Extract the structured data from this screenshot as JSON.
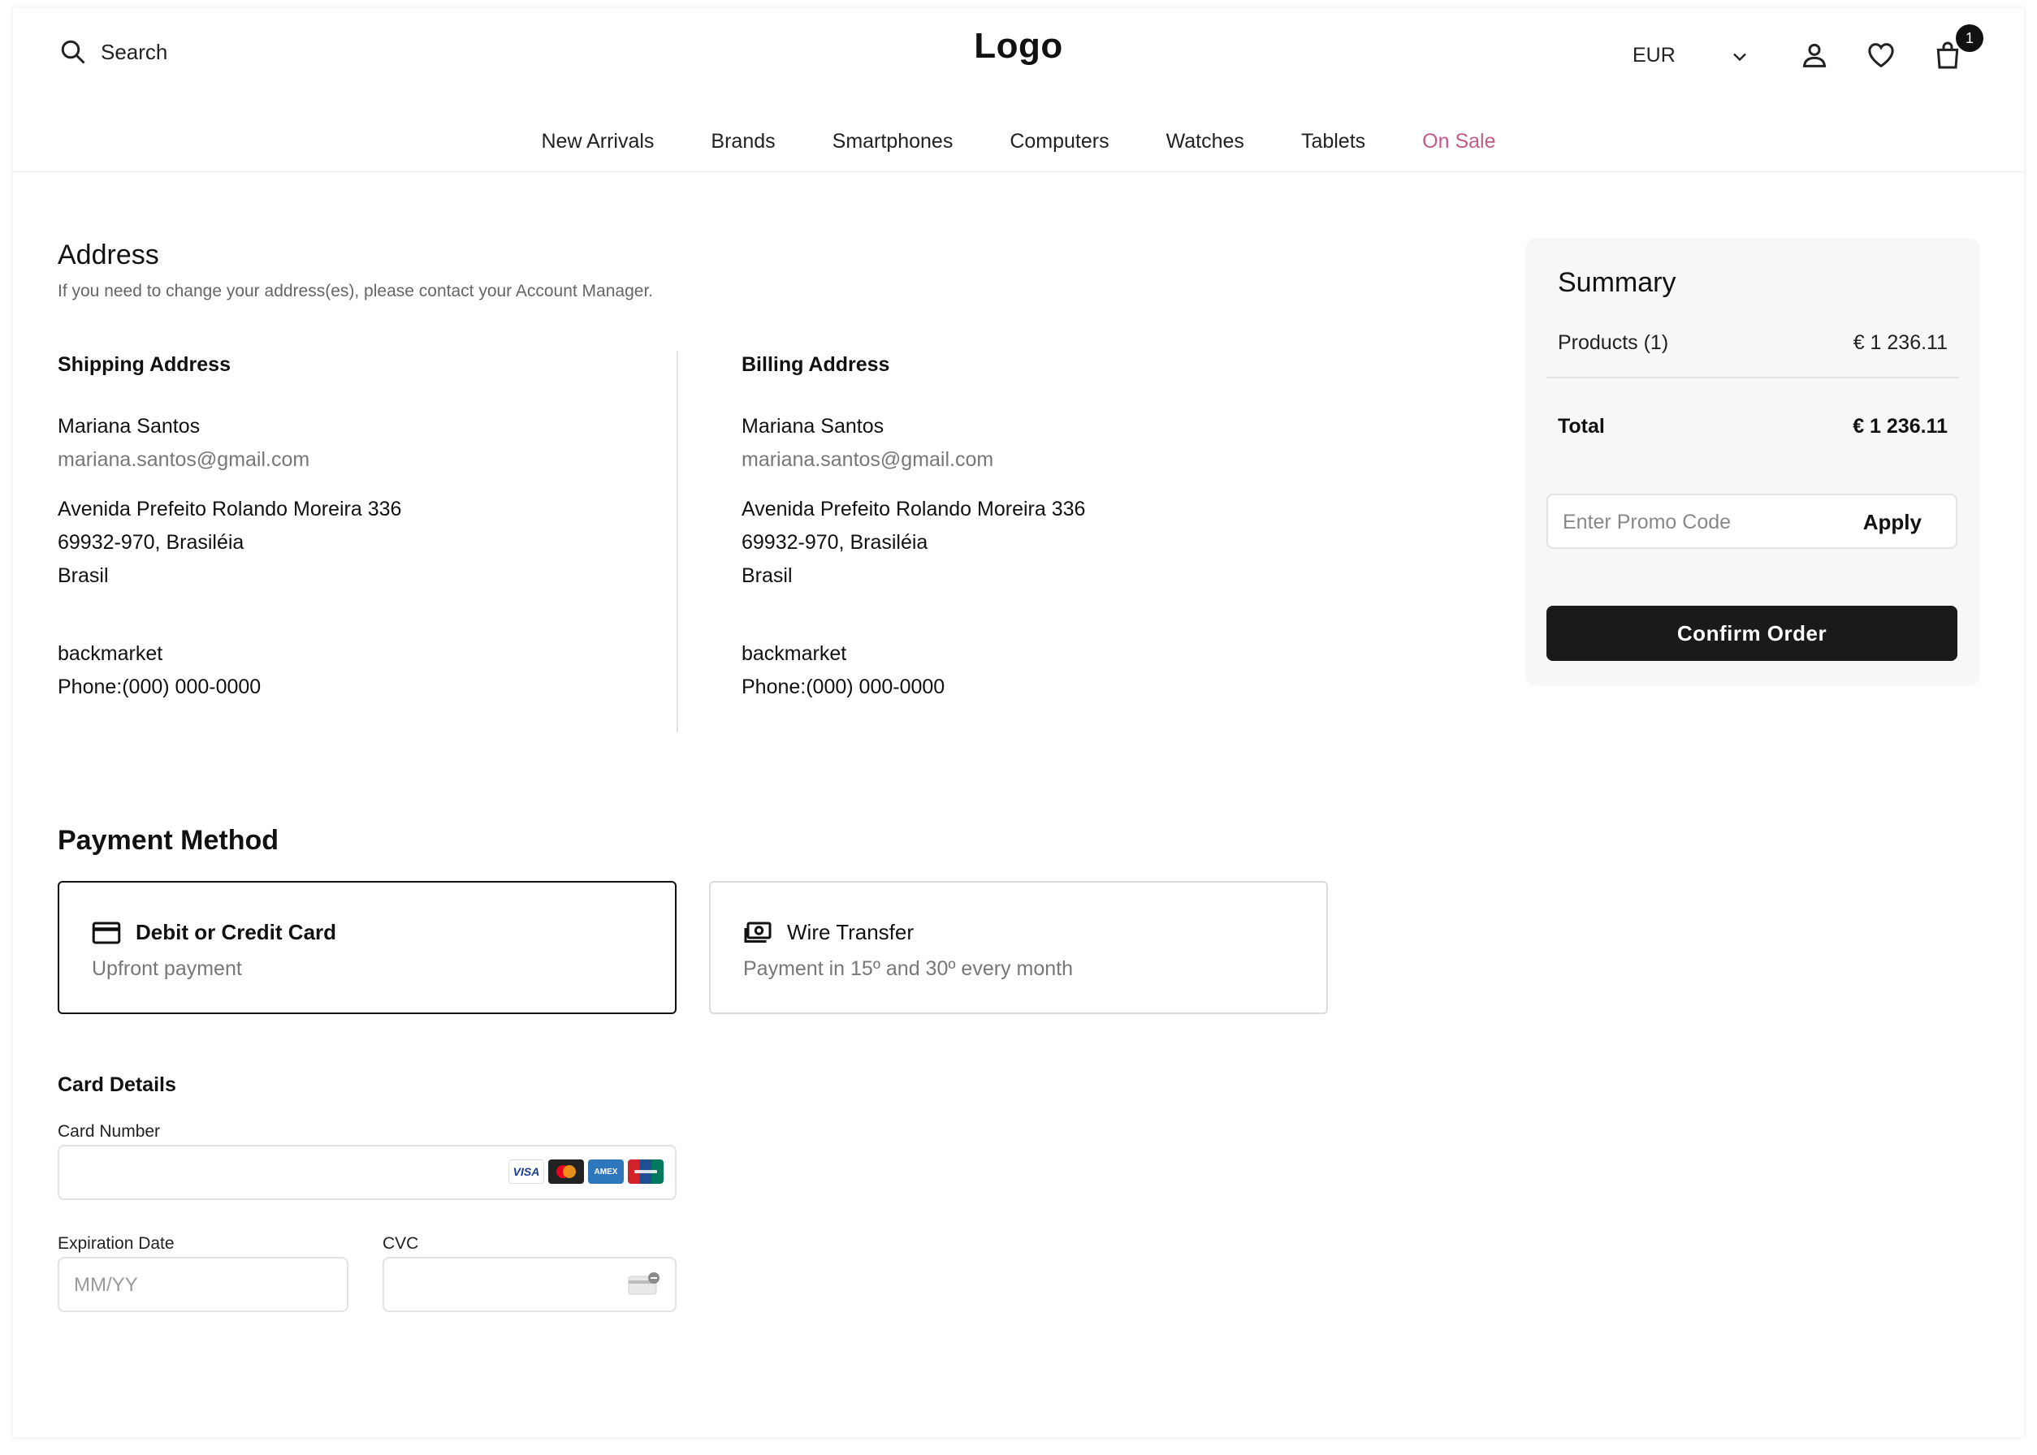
{
  "header": {
    "search_label": "Search",
    "logo": "Logo",
    "currency": "EUR",
    "cart_count": "1"
  },
  "nav": [
    {
      "label": "New Arrivals"
    },
    {
      "label": "Brands"
    },
    {
      "label": "Smartphones"
    },
    {
      "label": "Computers"
    },
    {
      "label": "Watches"
    },
    {
      "label": "Tablets"
    },
    {
      "label": "On Sale",
      "accent": "#c45a8a"
    }
  ],
  "address": {
    "title": "Address",
    "subtitle": "If you need to change your address(es), please contact your Account Manager.",
    "shipping": {
      "title": "Shipping Address",
      "name": "Mariana Santos",
      "email": "mariana.santos@gmail.com",
      "street": "Avenida Prefeito Rolando Moreira 336",
      "city": "69932-970, Brasiléia",
      "country": "Brasil",
      "company": "backmarket",
      "phone": "Phone:(000) 000-0000"
    },
    "billing": {
      "title": "Billing Address",
      "name": "Mariana Santos",
      "email": "mariana.santos@gmail.com",
      "street": "Avenida Prefeito Rolando Moreira 336",
      "city": "69932-970, Brasiléia",
      "country": "Brasil",
      "company": "backmarket",
      "phone": "Phone:(000) 000-0000"
    }
  },
  "summary": {
    "title": "Summary",
    "products_label": "Products (1)",
    "products_value": "€ 1 236.11",
    "total_label": "Total",
    "total_value": "€ 1 236.11",
    "promo_placeholder": "Enter Promo Code",
    "apply_label": "Apply",
    "confirm_label": "Confirm Order"
  },
  "payment": {
    "title": "Payment Method",
    "options": [
      {
        "title": "Debit or Credit Card",
        "desc": "Upfront payment",
        "selected": true,
        "icon": "credit-card-icon"
      },
      {
        "title": "Wire Transfer",
        "desc": "Payment in 15º and 30º every month",
        "selected": false,
        "icon": "money-icon"
      }
    ],
    "card_details": {
      "title": "Card Details",
      "card_number_label": "Card Number",
      "card_number_value": "",
      "expiration_label": "Expiration Date",
      "expiration_placeholder": "MM/YY",
      "cvc_label": "CVC",
      "cvc_value": "",
      "brands": [
        "VISA",
        "Mastercard",
        "AMEX",
        "UnionPay"
      ]
    }
  },
  "colors": {
    "accent_sale": "#c45a8a",
    "primary_button": "#1a1a1a",
    "summary_bg": "#f7f7f7"
  }
}
